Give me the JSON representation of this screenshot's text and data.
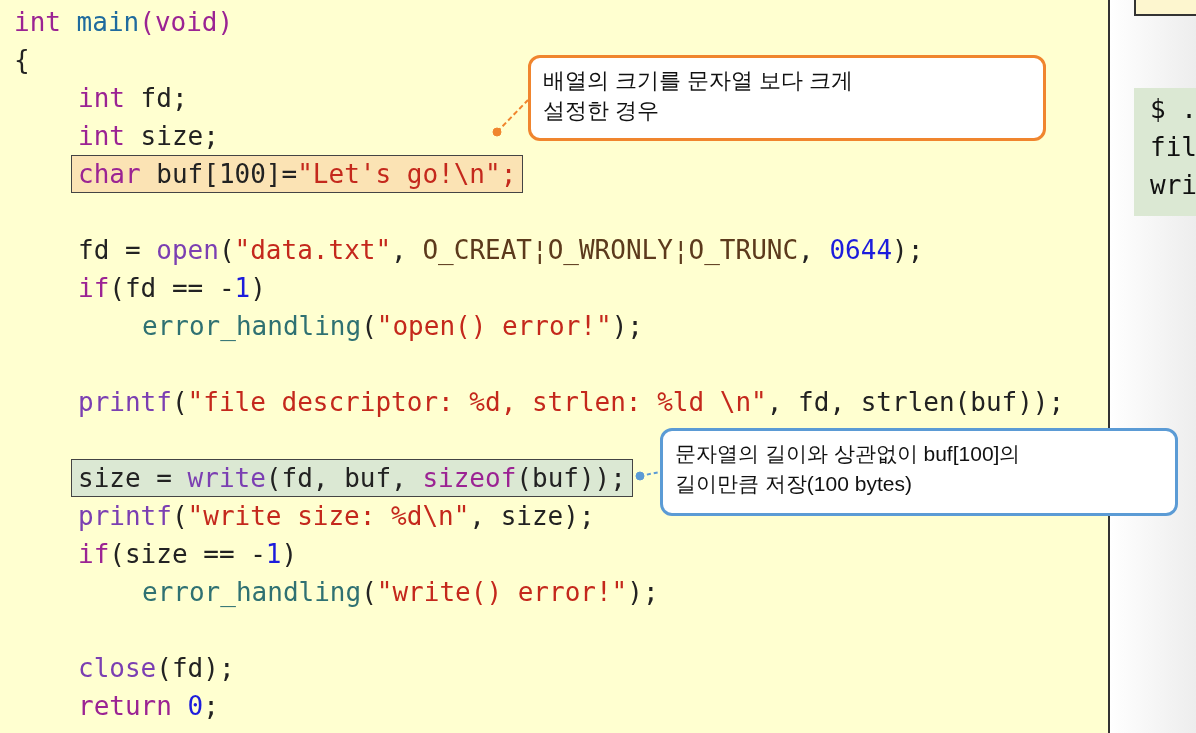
{
  "code": {
    "lines": [
      {
        "kind": "code",
        "tokens": [
          {
            "kind": "kw",
            "text": "int"
          },
          {
            "kind": "def",
            "text": " main"
          },
          {
            "kind": "kw",
            "text": "(void)"
          }
        ]
      },
      {
        "kind": "code",
        "tokens": [
          {
            "kind": "plain",
            "text": "{"
          }
        ],
        "children": [
          {
            "kind": "code",
            "tokens": [
              {
                "kind": "kw",
                "text": "int"
              },
              {
                "kind": "plain",
                "text": " fd;"
              }
            ]
          },
          {
            "kind": "code",
            "tokens": [
              {
                "kind": "kw",
                "text": "int"
              },
              {
                "kind": "plain",
                "text": " size;"
              }
            ]
          },
          {
            "kind": "code",
            "color": "#fbe3b4",
            "tokens": [
              {
                "kind": "kw",
                "text": "char"
              },
              {
                "kind": "plain",
                "text": " buf[100]="
              },
              {
                "kind": "str",
                "text": "\"Let's go!\\n\";"
              }
            ]
          },
          {
            "kind": "blank"
          },
          {
            "kind": "code",
            "tokens": [
              {
                "kind": "plain",
                "text": "fd = "
              },
              {
                "kind": "call",
                "text": "open"
              },
              {
                "kind": "plain",
                "text": "("
              },
              {
                "kind": "str",
                "text": "\"data.txt\""
              },
              {
                "kind": "plain",
                "text": ", "
              },
              {
                "kind": "macro",
                "text": "O_CREAT¦O_WRONLY¦O_TRUNC"
              },
              {
                "kind": "plain",
                "text": ", "
              },
              {
                "kind": "num",
                "text": "0644"
              },
              {
                "kind": "plain",
                "text": ");"
              }
            ]
          },
          {
            "kind": "code",
            "tokens": [
              {
                "kind": "kw",
                "text": "if"
              },
              {
                "kind": "plain",
                "text": "(fd == -"
              },
              {
                "kind": "num",
                "text": "1"
              },
              {
                "kind": "plain",
                "text": ")"
              }
            ],
            "children": [
              {
                "kind": "code",
                "tokens": [
                  {
                    "kind": "func",
                    "text": "error_handling"
                  },
                  {
                    "kind": "plain",
                    "text": "("
                  },
                  {
                    "kind": "str",
                    "text": "\"open() error!\""
                  },
                  {
                    "kind": "plain",
                    "text": ");"
                  }
                ]
              }
            ]
          },
          {
            "kind": "blank"
          },
          {
            "kind": "code",
            "tokens": [
              {
                "kind": "call",
                "text": "printf"
              },
              {
                "kind": "plain",
                "text": "("
              },
              {
                "kind": "str",
                "text": "\"file descriptor: %d, strlen: %ld \\n\""
              },
              {
                "kind": "plain",
                "text": ", fd, strlen(buf));"
              }
            ]
          },
          {
            "kind": "blank"
          },
          {
            "kind": "code",
            "color": "#dbe8d3",
            "tokens": [
              {
                "kind": "plain",
                "text": "size = "
              },
              {
                "kind": "call",
                "text": "write"
              },
              {
                "kind": "plain",
                "text": "(fd, buf, "
              },
              {
                "kind": "kw",
                "text": "sizeof"
              },
              {
                "kind": "plain",
                "text": "(buf));"
              }
            ]
          },
          {
            "kind": "code",
            "tokens": [
              {
                "kind": "call",
                "text": "printf"
              },
              {
                "kind": "plain",
                "text": "("
              },
              {
                "kind": "str",
                "text": "\"write size: %d\\n\""
              },
              {
                "kind": "plain",
                "text": ", size);"
              }
            ]
          },
          {
            "kind": "code",
            "tokens": [
              {
                "kind": "kw",
                "text": "if"
              },
              {
                "kind": "plain",
                "text": "(size == -"
              },
              {
                "kind": "num",
                "text": "1"
              },
              {
                "kind": "plain",
                "text": ")"
              }
            ],
            "children": [
              {
                "kind": "code",
                "tokens": [
                  {
                    "kind": "func",
                    "text": "error_handling"
                  },
                  {
                    "kind": "plain",
                    "text": "("
                  },
                  {
                    "kind": "str",
                    "text": "\"write() error!\""
                  },
                  {
                    "kind": "plain",
                    "text": ");"
                  }
                ]
              }
            ]
          },
          {
            "kind": "blank"
          },
          {
            "kind": "code",
            "tokens": [
              {
                "kind": "call",
                "text": "close"
              },
              {
                "kind": "plain",
                "text": "(fd);"
              }
            ]
          },
          {
            "kind": "code",
            "tokens": [
              {
                "kind": "kw",
                "text": "return"
              },
              {
                "kind": "num",
                "text": " 0"
              },
              {
                "kind": "plain",
                "text": ";"
              }
            ]
          }
        ]
      }
    ]
  },
  "callouts": [
    {
      "color": "#f0852e",
      "text": "배열의 크기를 문자열 보다 크게\n설정한 경우"
    },
    {
      "color": "#5b9bd5",
      "text": "문자열의 길이와 상관없이 buf[100]의\n길이만큼 저장(100 bytes)"
    }
  ],
  "output": {
    "lines": [
      "$ .",
      "fil",
      "wri"
    ]
  }
}
